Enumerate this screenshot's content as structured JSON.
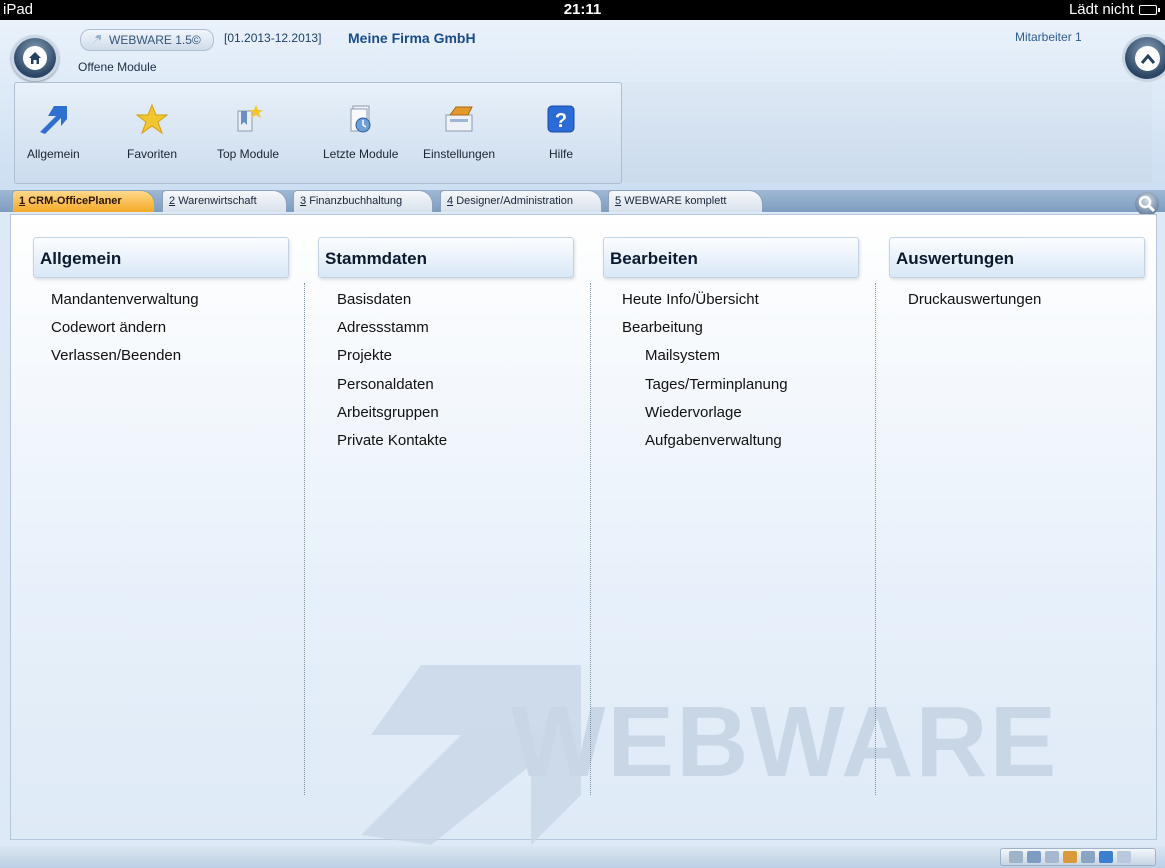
{
  "status_bar": {
    "device": "iPad",
    "time": "21:11",
    "battery_text": "Lädt nicht"
  },
  "header": {
    "app_version": "WEBWARE 1.5©",
    "period": "[01.2013-12.2013]",
    "company": "Meine Firma GmbH",
    "employee": "Mitarbeiter 1",
    "open_modules": "Offene Module"
  },
  "toolbar": [
    {
      "label": "Allgemein",
      "icon": "arrow-icon",
      "color": "#2f6fd0"
    },
    {
      "label": "Favoriten",
      "icon": "star-icon",
      "color": "#f2c630"
    },
    {
      "label": "Top Module",
      "icon": "bookmark-icon",
      "color": "#c8a040"
    },
    {
      "label": "Letzte Module",
      "icon": "recent-icon",
      "color": "#5a8fc0"
    },
    {
      "label": "Einstellungen",
      "icon": "settings-icon",
      "color": "#e08a20"
    },
    {
      "label": "Hilfe",
      "icon": "help-icon",
      "color": "#2a6bd6"
    }
  ],
  "tabs": [
    {
      "num": "1",
      "label": "CRM-OfficePlaner",
      "active": true
    },
    {
      "num": "2",
      "label": "Warenwirtschaft",
      "active": false
    },
    {
      "num": "3",
      "label": "Finanzbuchhaltung",
      "active": false
    },
    {
      "num": "4",
      "label": "Designer/Administration",
      "active": false
    },
    {
      "num": "5",
      "label": "WEBWARE komplett",
      "active": false
    }
  ],
  "columns": [
    {
      "title": "Allgemein",
      "items": [
        "Mandantenverwaltung",
        "Codewort ändern",
        "Verlassen/Beenden"
      ]
    },
    {
      "title": "Stammdaten",
      "items": [
        "Basisdaten",
        "Adressstamm",
        "Projekte",
        "Personaldaten",
        "Arbeitsgruppen",
        "Private Kontakte"
      ]
    },
    {
      "title": "Bearbeiten",
      "items": [
        "Heute Info/Übersicht",
        "Bearbeitung",
        "Mailsystem",
        "Tages/Terminplanung",
        "Wiedervorlage",
        "Aufgabenverwaltung"
      ]
    },
    {
      "title": "Auswertungen",
      "items": [
        "Druckauswertungen"
      ]
    }
  ],
  "watermark": "WEBWARE"
}
